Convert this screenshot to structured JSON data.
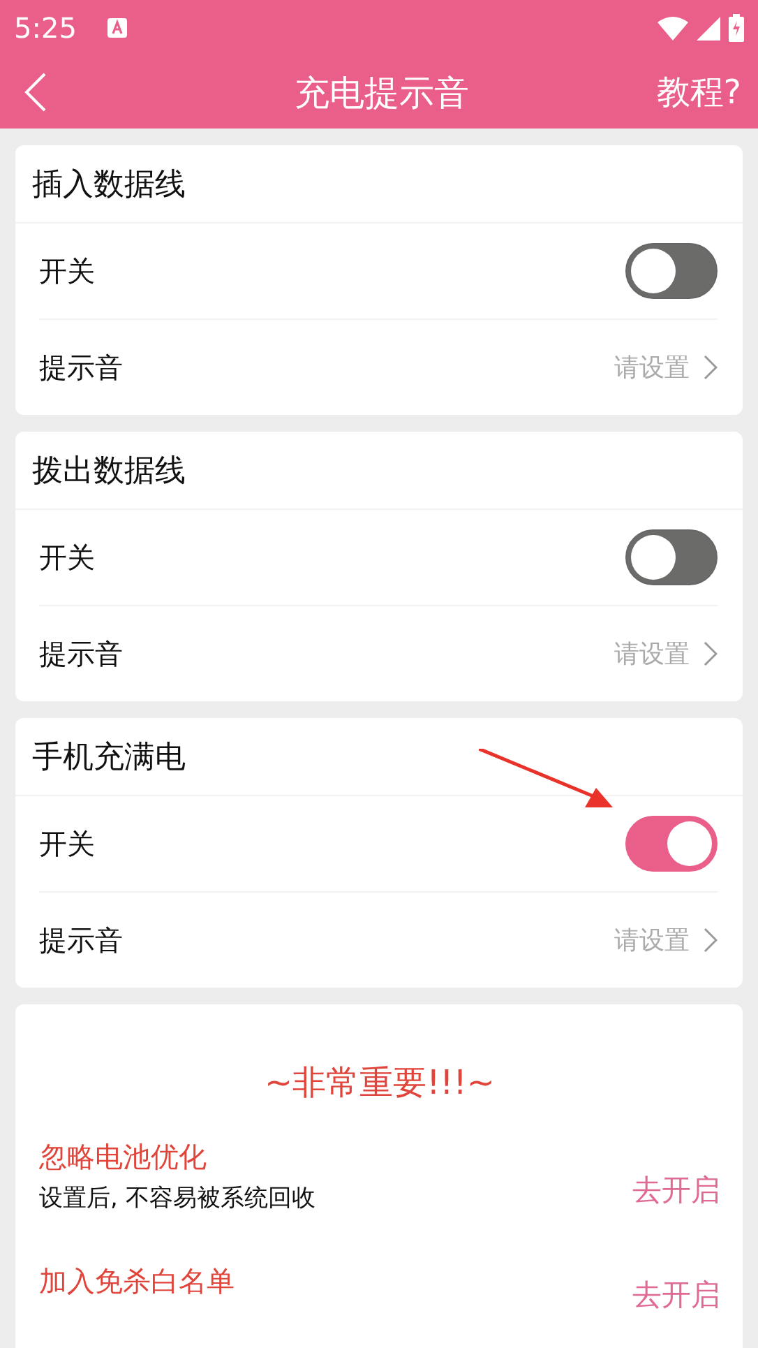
{
  "status_bar": {
    "time": "5:25"
  },
  "header": {
    "title": "充电提示音",
    "action": "教程?"
  },
  "sections": [
    {
      "title": "插入数据线",
      "switch_label": "开关",
      "on": false,
      "sound_label": "提示音",
      "sound_value": "请设置"
    },
    {
      "title": "拨出数据线",
      "switch_label": "开关",
      "on": false,
      "sound_label": "提示音",
      "sound_value": "请设置"
    },
    {
      "title": "手机充满电",
      "switch_label": "开关",
      "on": true,
      "sound_label": "提示音",
      "sound_value": "请设置",
      "annotated": true
    }
  ],
  "important": {
    "heading": "~非常重要!!!~",
    "items": [
      {
        "title": "忽略电池优化",
        "description": "设置后, 不容易被系统回收",
        "action": "去开启"
      },
      {
        "title": "加入免杀白名单",
        "action": "去开启"
      }
    ]
  }
}
